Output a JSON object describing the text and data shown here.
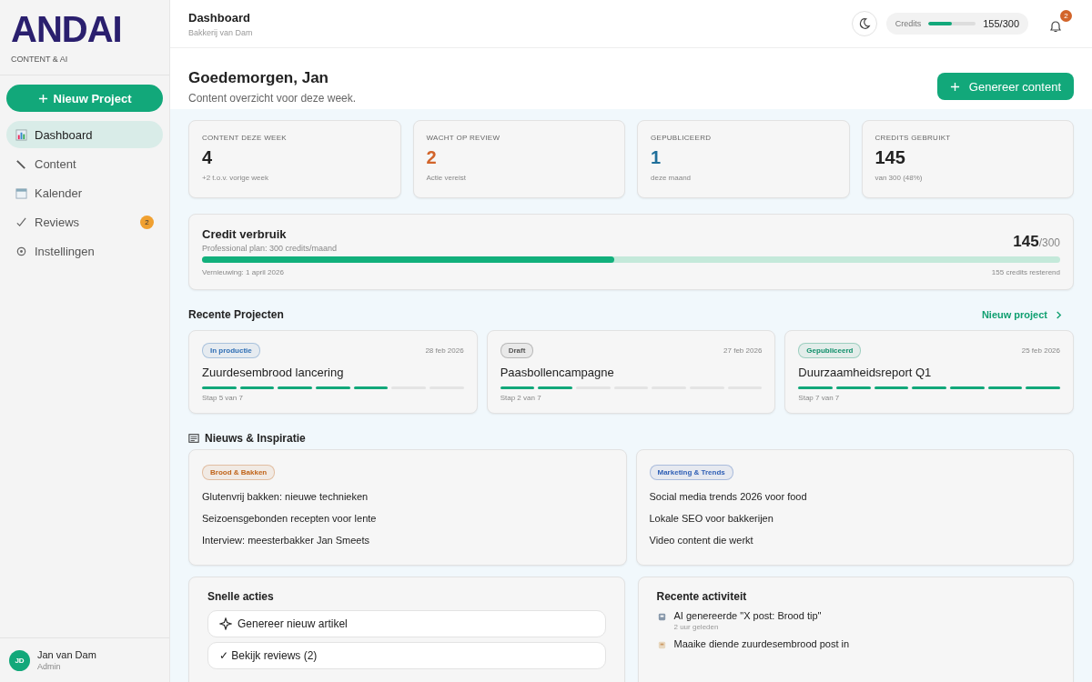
{
  "sidebar": {
    "logo": "ANDAI",
    "logo_sub": "CONTENT & AI",
    "new_button": "Nieuw Project",
    "items": [
      {
        "label": "Dashboard",
        "selected": true
      },
      {
        "label": "Content",
        "selected": false
      },
      {
        "label": "Kalender",
        "selected": false
      },
      {
        "label": "Reviews",
        "selected": false,
        "badge": "2"
      },
      {
        "label": "Instellingen",
        "selected": false
      }
    ],
    "user": {
      "initials": "JD",
      "name": "Jan van Dam",
      "role": "Admin"
    }
  },
  "header": {
    "title": "Dashboard",
    "subtitle": "Bakkerij van Dam",
    "credits": {
      "label": "Credits",
      "level": 0.5,
      "reading": "155/300"
    },
    "notification_count": "2"
  },
  "greeting": {
    "title": "Goedemorgen, Jan",
    "subtitle": "Content overzicht voor deze week.",
    "button": "Genereer content"
  },
  "stats": [
    {
      "label": "CONTENT DEZE WEEK",
      "value": "4",
      "note": "+2 t.o.v. vorige week",
      "color": "#222222"
    },
    {
      "label": "WACHT OP REVIEW",
      "value": "2",
      "note": "Actie vereist",
      "color": "#d2642a"
    },
    {
      "label": "GEPUBLICEERD",
      "value": "1",
      "note": "deze maand",
      "color": "#1f6f9a"
    },
    {
      "label": "CREDITS GEBRUIKT",
      "value": "145",
      "note": "van 300 (48%)",
      "color": "#222222"
    }
  ],
  "credit_usage": {
    "title": "Credit verbruik",
    "subtitle": "Professional plan: 300 credits/maand",
    "used": "145",
    "total": "/300",
    "level": 0.48,
    "renewal": "Vernieuwing: 1 april 2026",
    "remaining": "155 credits resterend"
  },
  "projects": {
    "title": "Recente Projecten",
    "link": "Nieuw project",
    "items": [
      {
        "status": "In productie",
        "color": "#2f6fb5",
        "date": "28 feb 2026",
        "name": "Zuurdesembrood lancering",
        "segments": [
          {
            "done": true
          },
          {
            "done": true
          },
          {
            "done": true
          },
          {
            "done": true
          },
          {
            "done": true
          },
          {
            "done": false
          },
          {
            "done": false
          }
        ],
        "step": "Stap 5 van 7"
      },
      {
        "status": "Draft",
        "color": "#555555",
        "date": "27 feb 2026",
        "name": "Paasbollencampagne",
        "segments": [
          {
            "done": true
          },
          {
            "done": true
          },
          {
            "done": false
          },
          {
            "done": false
          },
          {
            "done": false
          },
          {
            "done": false
          },
          {
            "done": false
          }
        ],
        "step": "Stap 2 van 7"
      },
      {
        "status": "Gepubliceerd",
        "color": "#0f8f6a",
        "date": "25 feb 2026",
        "name": "Duurzaamheidsreport Q1",
        "segments": [
          {
            "done": true
          },
          {
            "done": true
          },
          {
            "done": true
          },
          {
            "done": true
          },
          {
            "done": true
          },
          {
            "done": true
          },
          {
            "done": true
          }
        ],
        "step": "Stap 7 van 7"
      }
    ]
  },
  "news": {
    "title": "Nieuws & Inspiratie",
    "cards": [
      {
        "tag": "Brood & Bakken",
        "color": "#c0641a",
        "items": [
          "Glutenvrij bakken: nieuwe technieken",
          "Seizoensgebonden recepten voor lente",
          "Interview: meesterbakker Jan Smeets"
        ]
      },
      {
        "tag": "Marketing & Trends",
        "color": "#2f5fb5",
        "items": [
          "Social media trends 2026 voor food",
          "Lokale SEO voor bakkerijen",
          "Video content die werkt"
        ]
      }
    ]
  },
  "quick_actions": {
    "title": "Snelle acties",
    "items": [
      {
        "label": "Genereer nieuw artikel"
      },
      {
        "label": "✓ Bekijk reviews (2)"
      }
    ]
  },
  "activity": {
    "title": "Recente activiteit",
    "items": [
      {
        "text": "AI genereerde \"X post: Brood tip\"",
        "time": "2 uur geleden"
      },
      {
        "text": "Maaike diende zuurdesembrood post in"
      }
    ]
  }
}
